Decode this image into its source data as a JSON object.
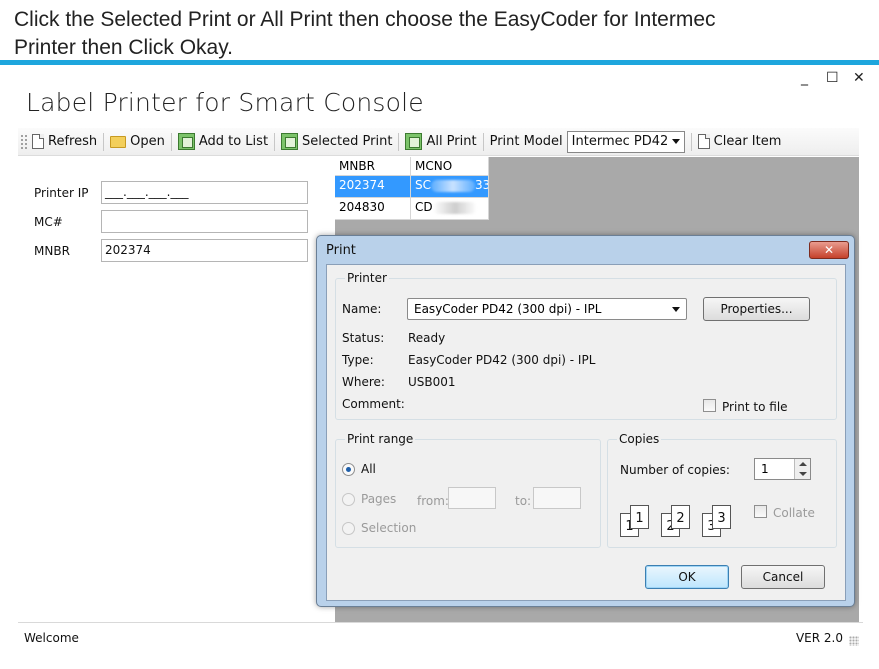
{
  "instruction": {
    "line1": "Click the Selected Print or All Print then choose the EasyCoder for Intermec",
    "line2": "Printer then Click Okay."
  },
  "window": {
    "title": "Label Printer for Smart Console",
    "minimize": "_",
    "maximize": "☐",
    "close": "✕"
  },
  "toolbar": {
    "refresh": "Refresh",
    "open": "Open",
    "add_to_list": "Add to List",
    "selected_print": "Selected Print",
    "all_print": "All Print",
    "print_model_label": "Print Model",
    "print_model_value": "Intermec PD42",
    "clear_item": "Clear Item"
  },
  "form": {
    "printer_ip_label": "Printer IP",
    "printer_ip_value": "___.___.___.___",
    "mc_label": "MC#",
    "mc_value": "",
    "mnbr_label": "MNBR",
    "mnbr_value": "202374"
  },
  "grid": {
    "headers": [
      "MNBR",
      "MCNO"
    ],
    "rows": [
      {
        "mnbr": "202374",
        "mcno_start": "SC",
        "mcno_end": "33",
        "selected": true
      },
      {
        "mnbr": "204830",
        "mcno_start": "CD",
        "mcno_end": "",
        "selected": false
      }
    ]
  },
  "status": {
    "left": "Welcome",
    "right": "VER 2.0"
  },
  "print_dialog": {
    "title": "Print",
    "close": "✕",
    "printer_group": "Printer",
    "name_label": "Name:",
    "name_value": "EasyCoder PD42 (300 dpi) - IPL",
    "properties": "Properties...",
    "status_label": "Status:",
    "status_value": "Ready",
    "type_label": "Type:",
    "type_value": "EasyCoder PD42 (300 dpi) - IPL",
    "where_label": "Where:",
    "where_value": "USB001",
    "comment_label": "Comment:",
    "print_to_file": "Print to file",
    "range_group": "Print range",
    "all": "All",
    "pages": "Pages",
    "from": "from:",
    "to": "to:",
    "selection": "Selection",
    "copies_group": "Copies",
    "number_of_copies": "Number of copies:",
    "copies_value": "1",
    "collate": "Collate",
    "ok": "OK",
    "cancel": "Cancel"
  },
  "colors": {
    "accent_rule": "#1ea6dd",
    "selection": "#3399ff",
    "dialog_frame": "#b9d1ea",
    "grid_background": "#a9a9a9"
  }
}
